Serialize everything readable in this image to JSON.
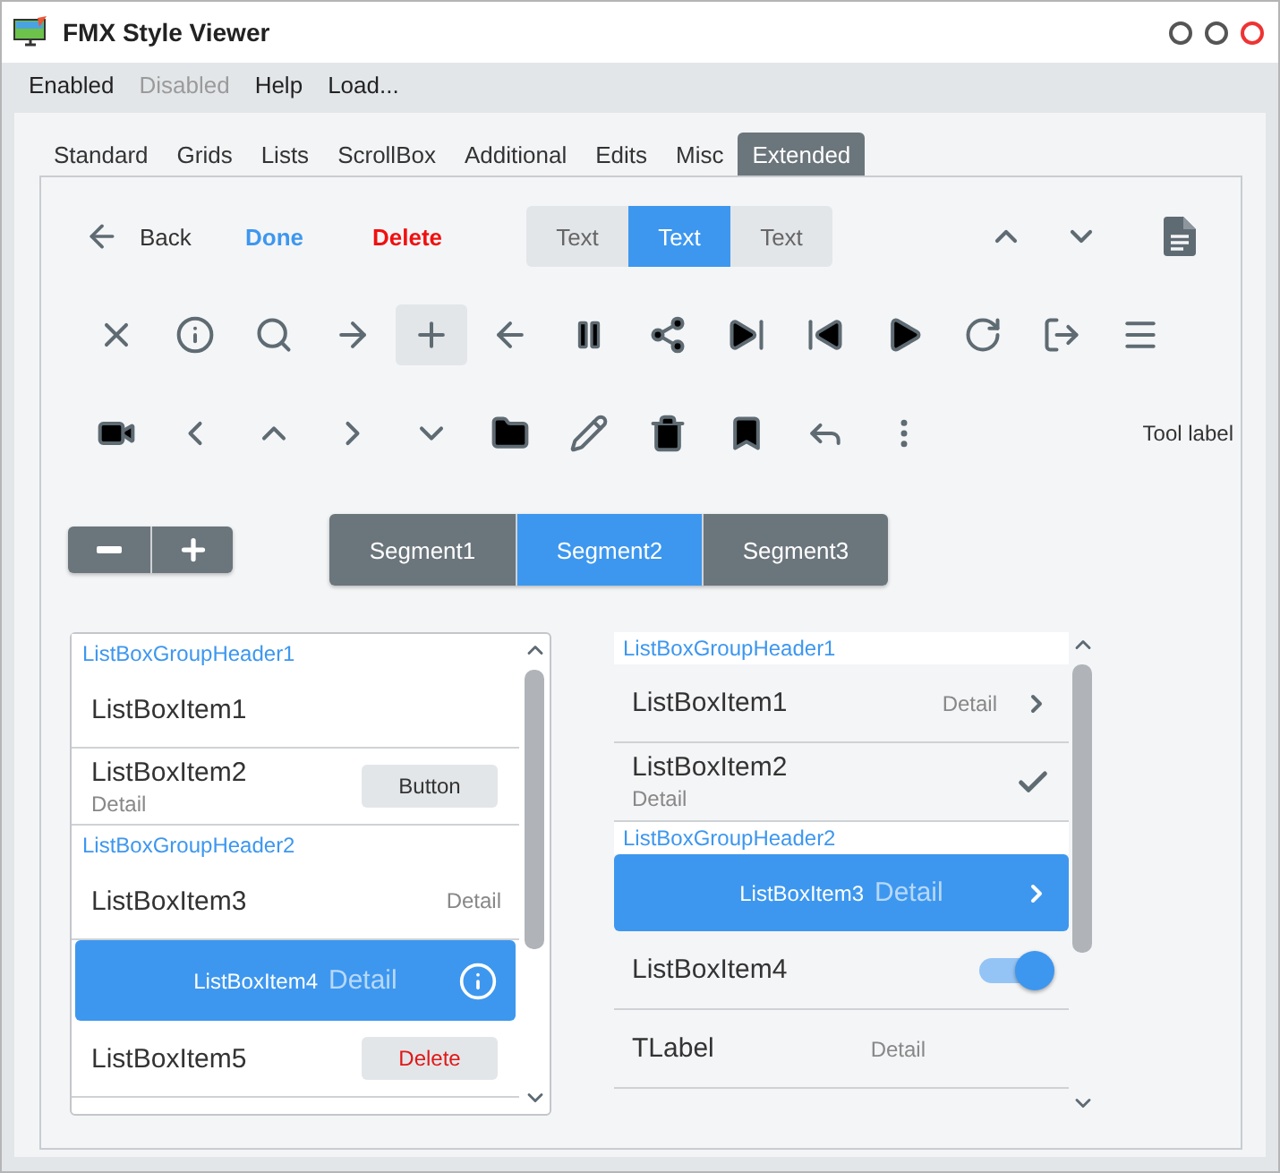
{
  "window": {
    "title": "FMX Style Viewer"
  },
  "menu": [
    {
      "label": "Enabled",
      "disabled": false
    },
    {
      "label": "Disabled",
      "disabled": true
    },
    {
      "label": "Help",
      "disabled": false
    },
    {
      "label": "Load...",
      "disabled": false
    }
  ],
  "tabs": [
    {
      "label": "Standard",
      "selected": false
    },
    {
      "label": "Grids",
      "selected": false
    },
    {
      "label": "Lists",
      "selected": false
    },
    {
      "label": "ScrollBox",
      "selected": false
    },
    {
      "label": "Additional",
      "selected": false
    },
    {
      "label": "Edits",
      "selected": false
    },
    {
      "label": "Misc",
      "selected": false
    },
    {
      "label": "Extended",
      "selected": true
    }
  ],
  "toolbar": {
    "back_button": "Back",
    "done_button": "Done",
    "delete_button": "Delete",
    "segmented": [
      {
        "label": "Text",
        "selected": false
      },
      {
        "label": "Text",
        "selected": true
      },
      {
        "label": "Text",
        "selected": false
      }
    ]
  },
  "icon_row": [
    {
      "selected": false
    },
    {
      "selected": false
    },
    {
      "selected": false
    },
    {
      "selected": false
    },
    {
      "selected": true
    },
    {
      "selected": false
    },
    {
      "selected": false
    },
    {
      "selected": false
    },
    {
      "selected": false
    },
    {
      "selected": false
    },
    {
      "selected": false
    },
    {
      "selected": false
    },
    {
      "selected": false
    },
    {
      "selected": false
    }
  ],
  "tool_label": "Tool label",
  "segments": [
    {
      "label": "Segment1",
      "selected": false
    },
    {
      "label": "Segment2",
      "selected": true
    },
    {
      "label": "Segment3",
      "selected": false
    }
  ],
  "list_left": [
    {
      "header": "ListBoxGroupHeader1",
      "items": [
        {
          "kind": "plain",
          "text": "ListBoxItem1",
          "selected": false
        },
        {
          "kind": "subtitle",
          "text": "ListBoxItem2",
          "detail": "Detail",
          "selected": false,
          "accessory": {
            "kind": "button",
            "label": "Button",
            "destructive": false
          }
        }
      ]
    },
    {
      "header": "ListBoxGroupHeader2",
      "items": [
        {
          "kind": "detail",
          "text": "ListBoxItem3",
          "detail": "Detail",
          "selected": false
        },
        {
          "kind": "detail",
          "text": "ListBoxItem4",
          "detail": "Detail",
          "selected": true,
          "accessory": {
            "kind": "info"
          }
        },
        {
          "kind": "plain",
          "text": "ListBoxItem5",
          "selected": false,
          "accessory": {
            "kind": "button",
            "label": "Delete",
            "destructive": true
          }
        }
      ]
    }
  ],
  "list_right": [
    {
      "header": "ListBoxGroupHeader1",
      "items": [
        {
          "kind": "detail",
          "text": "ListBoxItem1",
          "detail": "Detail",
          "selected": false,
          "accessory": {
            "kind": "chevron"
          }
        },
        {
          "kind": "subtitle",
          "text": "ListBoxItem2",
          "detail": "Detail",
          "selected": false,
          "accessory": {
            "kind": "check"
          }
        }
      ]
    },
    {
      "header": "ListBoxGroupHeader2",
      "items": [
        {
          "kind": "detail",
          "text": "ListBoxItem3",
          "detail": "Detail",
          "selected": true,
          "accessory": {
            "kind": "chevron"
          }
        },
        {
          "kind": "plain",
          "text": "ListBoxItem4",
          "selected": false,
          "accessory": {
            "kind": "switch",
            "on": true
          }
        },
        {
          "kind": "label",
          "text": "TLabel",
          "detail": "Detail",
          "selected": false
        }
      ]
    }
  ]
}
